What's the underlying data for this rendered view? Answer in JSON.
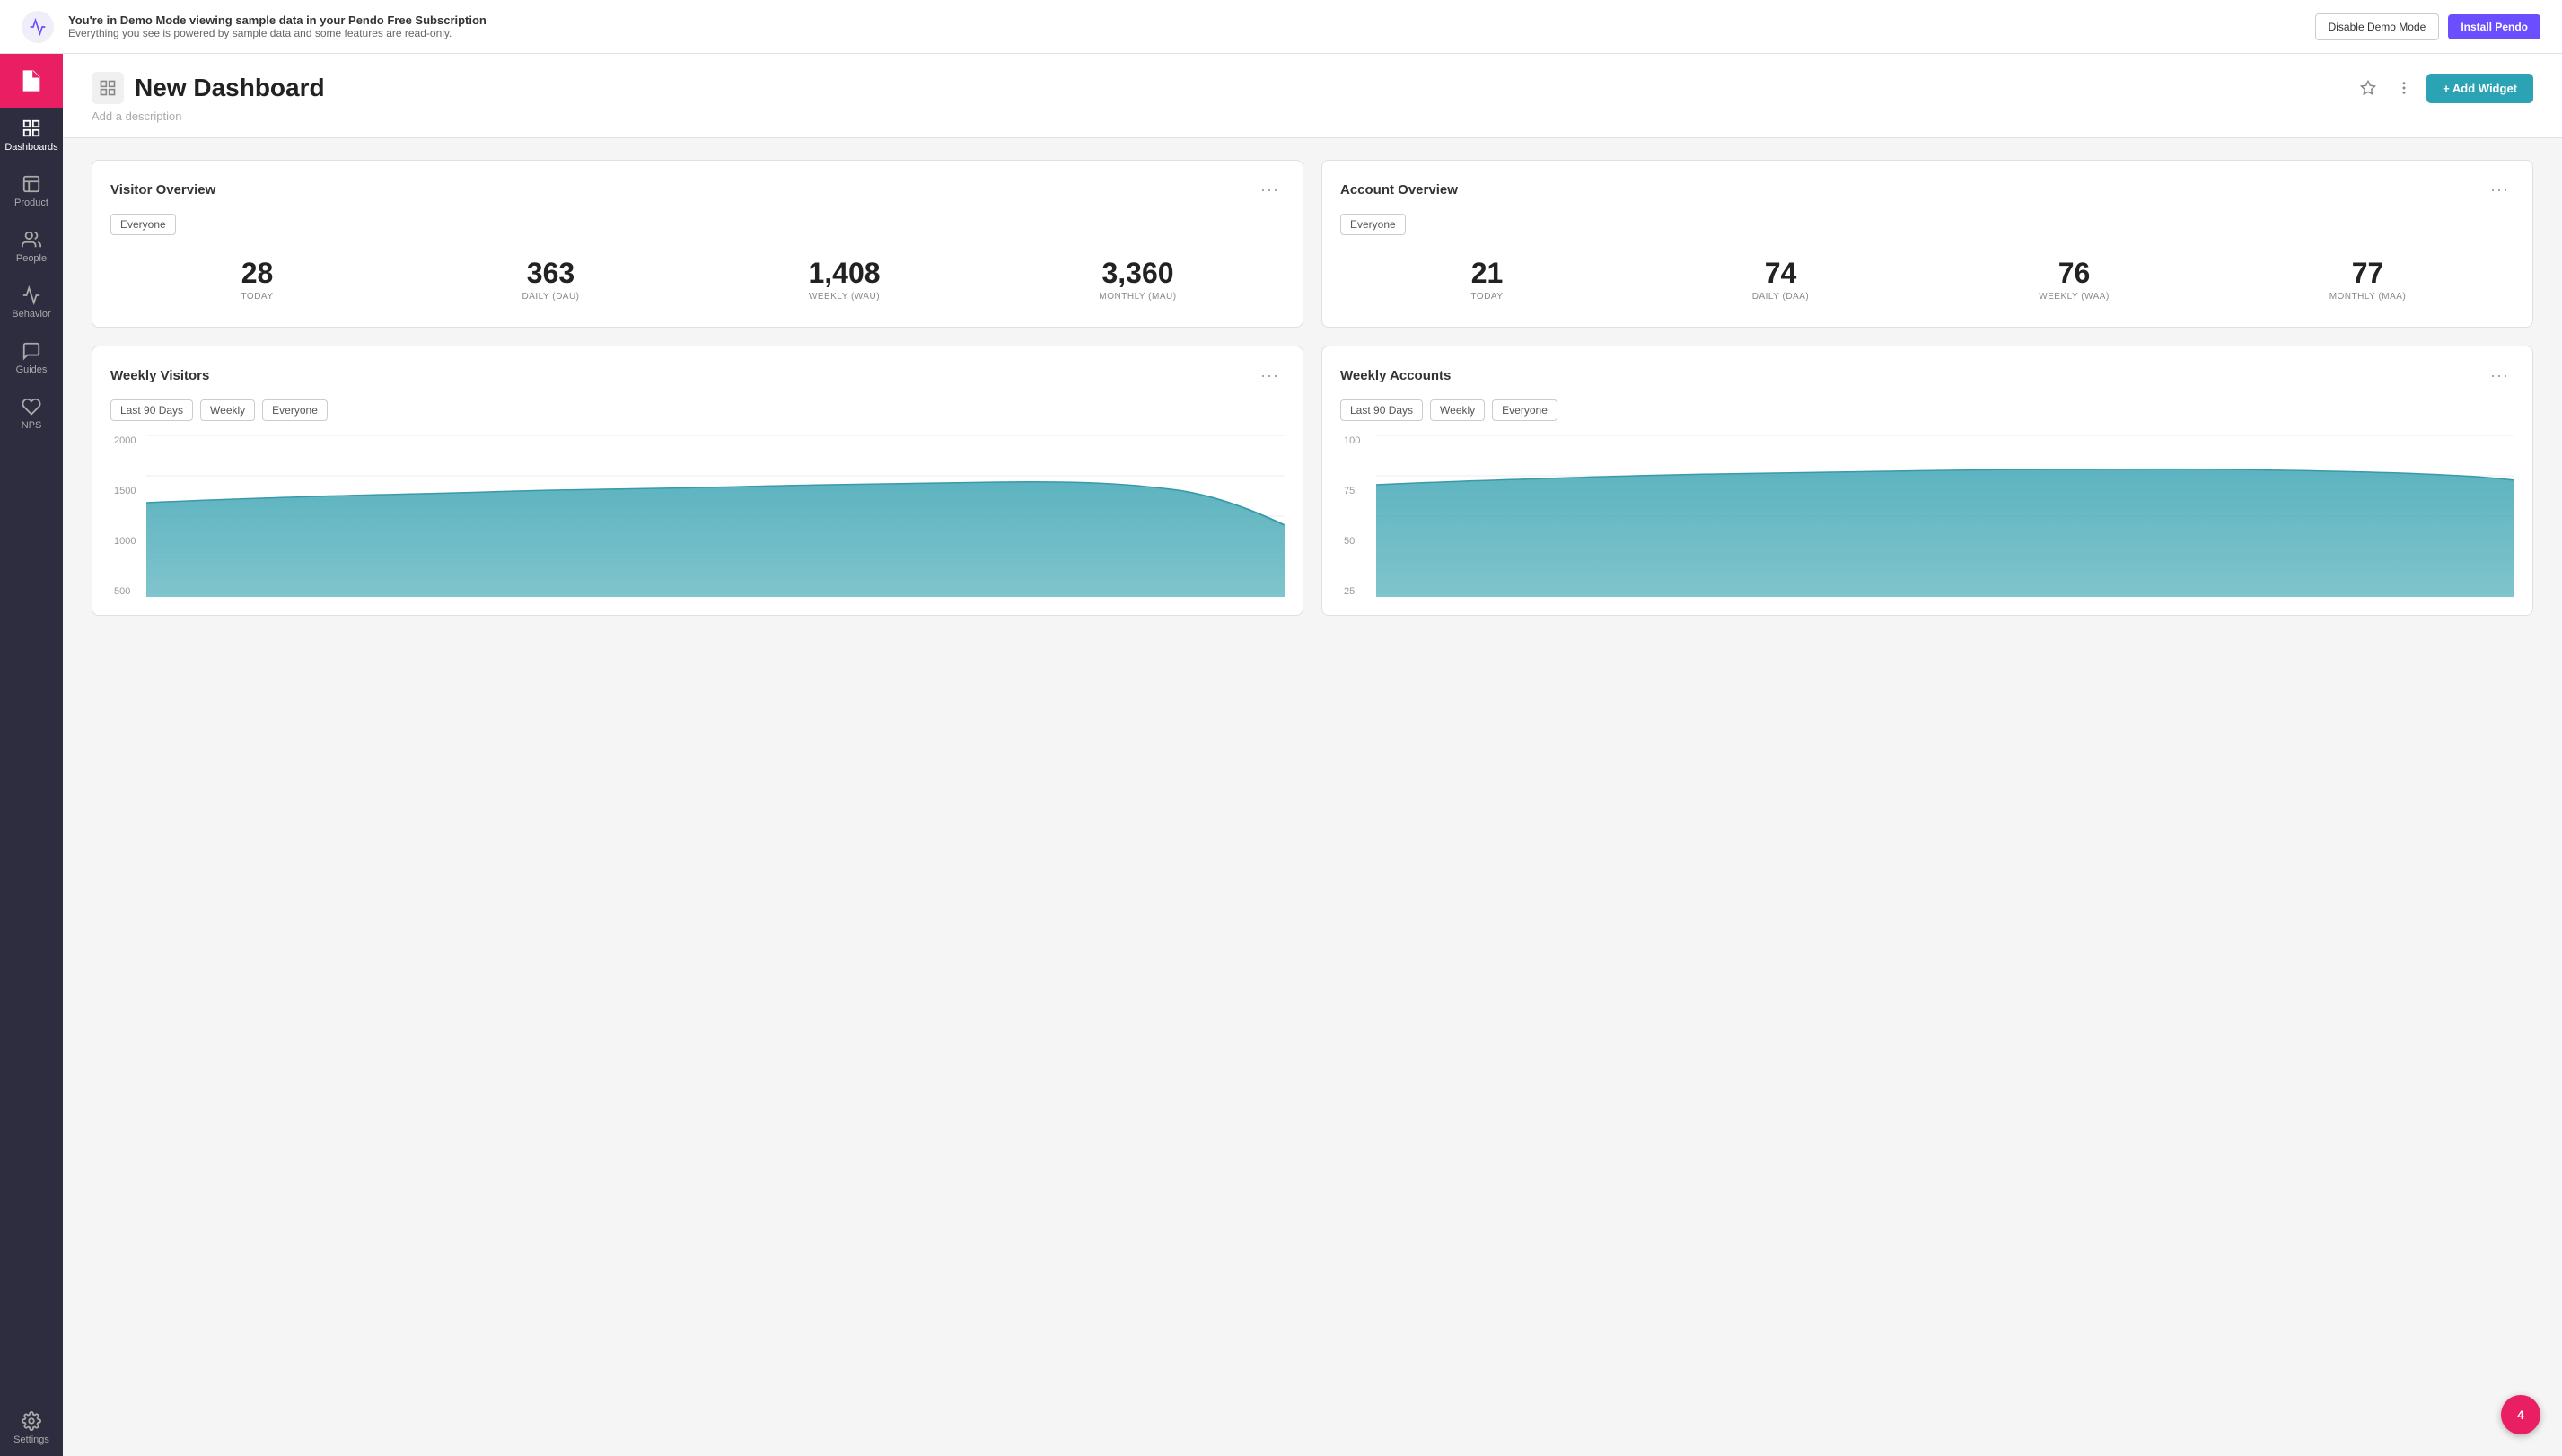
{
  "banner": {
    "title": "You're in Demo Mode viewing sample data in your Pendo Free Subscription",
    "subtitle": "Everything you see is powered by sample data and some features are read-only.",
    "disable_label": "Disable Demo Mode",
    "install_label": "Install Pendo"
  },
  "sidebar": {
    "items": [
      {
        "id": "dashboards",
        "label": "Dashboards",
        "active": true
      },
      {
        "id": "product",
        "label": "Product",
        "active": false
      },
      {
        "id": "people",
        "label": "People",
        "active": false
      },
      {
        "id": "behavior",
        "label": "Behavior",
        "active": false
      },
      {
        "id": "guides",
        "label": "Guides",
        "active": false
      },
      {
        "id": "nps",
        "label": "NPS",
        "active": false
      }
    ],
    "bottom": [
      {
        "id": "settings",
        "label": "Settings"
      }
    ]
  },
  "dashboard": {
    "title": "New Dashboard",
    "description": "Add a description",
    "add_widget_label": "+ Add Widget"
  },
  "widgets": {
    "visitor_overview": {
      "title": "Visitor Overview",
      "filter": "Everyone",
      "metrics": [
        {
          "value": "28",
          "label": "TODAY"
        },
        {
          "value": "363",
          "label": "DAILY (DAU)"
        },
        {
          "value": "1,408",
          "label": "WEEKLY (WAU)"
        },
        {
          "value": "3,360",
          "label": "MONTHLY (MAU)"
        }
      ]
    },
    "account_overview": {
      "title": "Account Overview",
      "filter": "Everyone",
      "metrics": [
        {
          "value": "21",
          "label": "TODAY"
        },
        {
          "value": "74",
          "label": "DAILY (DAA)"
        },
        {
          "value": "76",
          "label": "WEEKLY (WAA)"
        },
        {
          "value": "77",
          "label": "MONTHLY (MAA)"
        }
      ]
    },
    "weekly_visitors": {
      "title": "Weekly Visitors",
      "filters": [
        "Last 90 Days",
        "Weekly",
        "Everyone"
      ],
      "y_labels": [
        "2000",
        "1500",
        "1000",
        "500"
      ],
      "chart_color": "#4aabb8"
    },
    "weekly_accounts": {
      "title": "Weekly Accounts",
      "filters": [
        "Last 90 Days",
        "Weekly",
        "Everyone"
      ],
      "y_labels": [
        "100",
        "75",
        "50",
        "25"
      ],
      "chart_color": "#4aabb8"
    }
  },
  "notification_badge": "4"
}
